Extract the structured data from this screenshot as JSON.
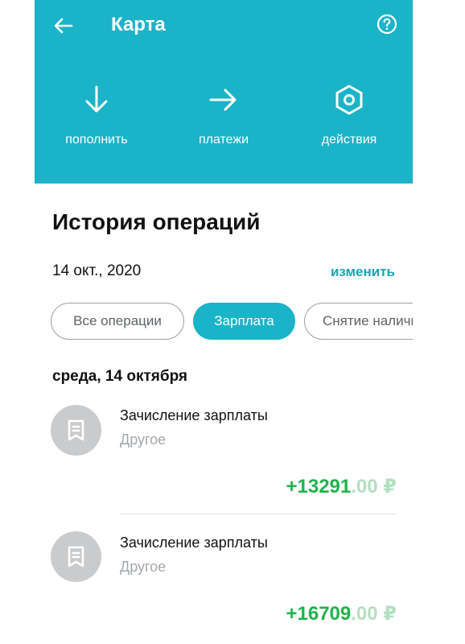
{
  "header": {
    "title": "Карта",
    "actions": [
      {
        "label": "пополнить",
        "icon": "arrow-down-icon"
      },
      {
        "label": "платежи",
        "icon": "arrow-right-icon"
      },
      {
        "label": "действия",
        "icon": "hexagon-settings-icon"
      }
    ]
  },
  "history": {
    "title": "История операций",
    "date": "14 окт., 2020",
    "change_label": "изменить"
  },
  "filters": [
    "Все операции",
    "Зарплата",
    "Снятие наличных"
  ],
  "active_filter": "Зарплата",
  "day_header": "среда, 14 октября",
  "operations": [
    {
      "name": "Зачисление зарплаты",
      "category": "Другое",
      "amount_int": "+13291",
      "amount_frac": ".00",
      "currency": "₽"
    },
    {
      "name": "Зачисление зарплаты",
      "category": "Другое",
      "amount_int": "+16709",
      "amount_frac": ".00",
      "currency": "₽"
    }
  ],
  "colors": {
    "accent": "#1bb3c8",
    "amount": "#1fb24a",
    "muted": "#a3a8ac"
  }
}
